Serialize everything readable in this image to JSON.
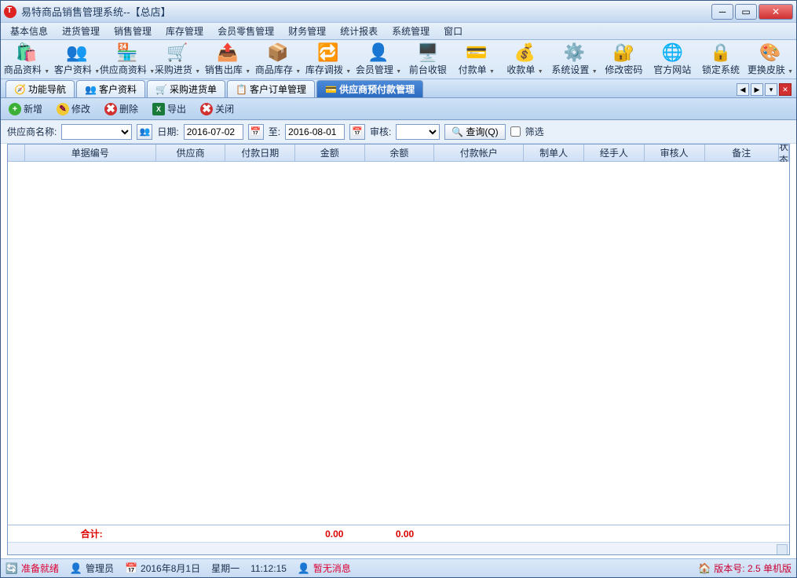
{
  "title": "易特商品销售管理系统--【总店】",
  "menus": [
    "基本信息",
    "进货管理",
    "销售管理",
    "库存管理",
    "会员零售管理",
    "财务管理",
    "统计报表",
    "系统管理",
    "窗口"
  ],
  "tools": [
    {
      "icon": "🛍️",
      "label": "商品资料",
      "arrow": true
    },
    {
      "icon": "👥",
      "label": "客户资料",
      "arrow": true
    },
    {
      "icon": "🏪",
      "label": "供应商资料",
      "arrow": true
    },
    {
      "icon": "🛒",
      "label": "采购进货",
      "arrow": true
    },
    {
      "icon": "📤",
      "label": "销售出库",
      "arrow": true
    },
    {
      "icon": "📦",
      "label": "商品库存",
      "arrow": true
    },
    {
      "icon": "🔁",
      "label": "库存调拨",
      "arrow": true
    },
    {
      "icon": "👤",
      "label": "会员管理",
      "arrow": true
    },
    {
      "icon": "🖥️",
      "label": "前台收银",
      "arrow": false
    },
    {
      "icon": "💳",
      "label": "付款单",
      "arrow": true
    },
    {
      "icon": "💰",
      "label": "收款单",
      "arrow": true
    },
    {
      "icon": "⚙️",
      "label": "系统设置",
      "arrow": true
    },
    {
      "icon": "🔐",
      "label": "修改密码",
      "arrow": false
    },
    {
      "icon": "🌐",
      "label": "官方网站",
      "arrow": false
    },
    {
      "icon": "🔒",
      "label": "锁定系统",
      "arrow": false
    },
    {
      "icon": "🎨",
      "label": "更换皮肤",
      "arrow": true
    }
  ],
  "tabs": [
    {
      "icon": "🧭",
      "label": "功能导航",
      "active": false
    },
    {
      "icon": "👥",
      "label": "客户资料",
      "active": false
    },
    {
      "icon": "🛒",
      "label": "采购进货单",
      "active": false
    },
    {
      "icon": "📋",
      "label": "客户订单管理",
      "active": false
    },
    {
      "icon": "💳",
      "label": "供应商预付款管理",
      "active": true
    }
  ],
  "panel_buttons": {
    "add": "新增",
    "edit": "修改",
    "del": "删除",
    "export": "导出",
    "close": "关闭"
  },
  "filter": {
    "supplier_label": "供应商名称:",
    "date_label": "日期:",
    "date_from": "2016-07-02",
    "to_label": "至:",
    "date_to": "2016-08-01",
    "audit_label": "审核:",
    "query_label": "查询(Q)",
    "filter_label": "筛选"
  },
  "columns": [
    "",
    "单据编号",
    "供应商",
    "付款日期",
    "金额",
    "余额",
    "付款帐户",
    "制单人",
    "经手人",
    "审核人",
    "备注",
    "状态"
  ],
  "totals": {
    "label": "合计:",
    "amount": "0.00",
    "balance": "0.00"
  },
  "status": {
    "ready": "准备就绪",
    "user": "管理员",
    "date": "2016年8月1日",
    "weekday": "星期一",
    "time": "11:12:15",
    "msg": "暂无消息",
    "version_label": "版本号:",
    "version": "2.5 单机版"
  }
}
